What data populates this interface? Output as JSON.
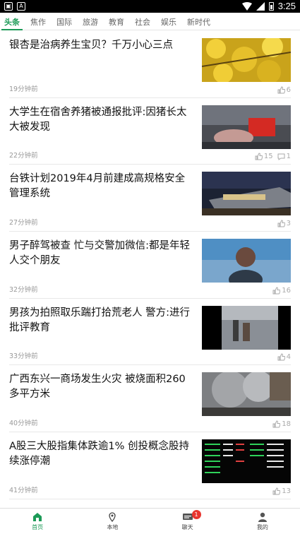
{
  "status_bar": {
    "time": "3:25"
  },
  "tabs": [
    {
      "label": "头条"
    },
    {
      "label": "焦作"
    },
    {
      "label": "国际"
    },
    {
      "label": "旅游"
    },
    {
      "label": "教育"
    },
    {
      "label": "社会"
    },
    {
      "label": "娱乐"
    },
    {
      "label": "新时代"
    }
  ],
  "news": [
    {
      "title": "银杏是治病养生宝贝？千万小心三点",
      "time": "19分钟前",
      "likes": "6"
    },
    {
      "title": "大学生在宿舍养猪被通报批评:因猪长太大被发现",
      "time": "22分钟前",
      "likes": "15",
      "comments": "1"
    },
    {
      "title": "台铁计划2019年4月前建成高规格安全管理系统",
      "time": "27分钟前",
      "likes": "3"
    },
    {
      "title": "男子醉驾被查 忙与交警加微信:都是年轻人交个朋友",
      "time": "32分钟前",
      "likes": "16"
    },
    {
      "title": "男孩为拍照取乐踹打拾荒老人 警方:进行批评教育",
      "time": "33分钟前",
      "likes": "4"
    },
    {
      "title": "广西东兴一商场发生火灾 被烧面积260多平方米",
      "time": "40分钟前",
      "likes": "18"
    },
    {
      "title": "A股三大股指集体跌逾1% 创投概念股持续涨停潮",
      "time": "41分钟前",
      "likes": "13"
    }
  ],
  "bottom_nav": {
    "home": "首页",
    "local": "本地",
    "chat": "聊天",
    "chat_badge": "1",
    "mine": "我的"
  },
  "colors": {
    "accent": "#1c9a57",
    "badge": "#e8352f"
  }
}
